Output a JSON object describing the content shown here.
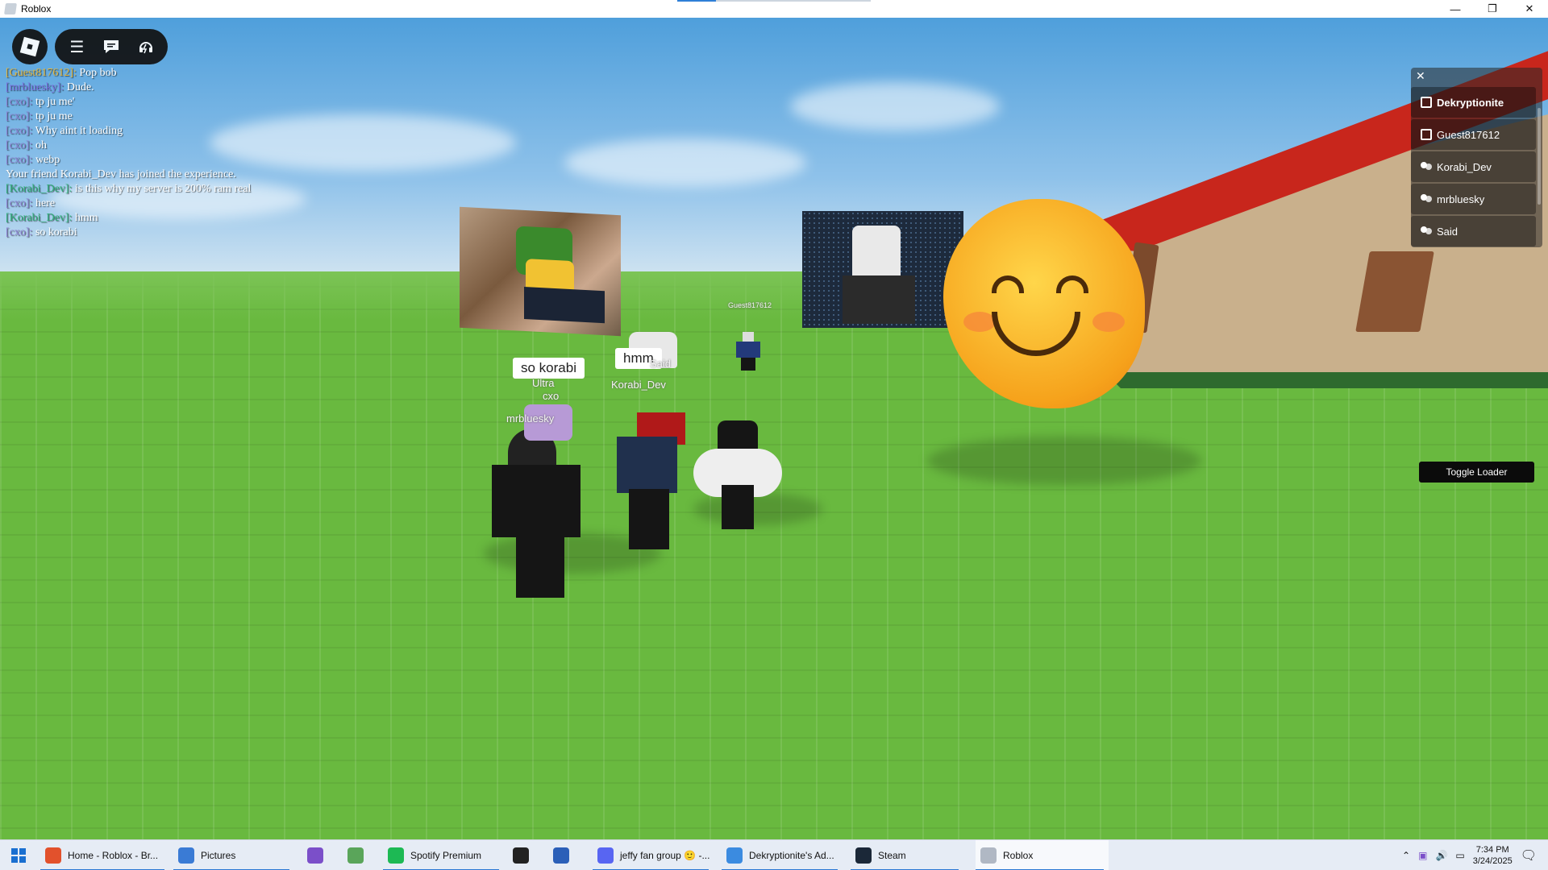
{
  "window": {
    "title": "Roblox",
    "loading_progress": 0.2
  },
  "menu": {
    "roblox_button_label": "",
    "icons": [
      "hamburger-icon",
      "chat-icon",
      "voice-icon"
    ]
  },
  "chat": {
    "messages": [
      {
        "name": "[Guest817612]:",
        "text": " Pop bob",
        "color": "#e6b73c"
      },
      {
        "name": "[mrbluesky]:",
        "text": " Dude.",
        "color": "#7a6fe0"
      },
      {
        "name": "[cxo]:",
        "text": " tp ju me'",
        "color": "#8b7fd3"
      },
      {
        "name": "[cxo]:",
        "text": " tp ju me",
        "color": "#8b7fd3"
      },
      {
        "name": "[cxo]:",
        "text": " Why aint it loading",
        "color": "#8b7fd3"
      },
      {
        "name": "[cxo]:",
        "text": " oh",
        "color": "#8b7fd3"
      },
      {
        "name": "[cxo]:",
        "text": " webp",
        "color": "#8b7fd3"
      },
      {
        "name": "",
        "text": "Your friend Korabi_Dev has joined the experience.",
        "color": "#ffffff"
      },
      {
        "name": "[Korabi_Dev]:",
        "text": " is this why my server is 200% ram real",
        "color": "#2fb07a"
      },
      {
        "name": "[cxo]:",
        "text": " here",
        "color": "#8b7fd3"
      },
      {
        "name": "[Korabi_Dev]:",
        "text": " hmm",
        "color": "#2fb07a"
      },
      {
        "name": "[cxo]:",
        "text": " so korabi",
        "color": "#8b7fd3"
      }
    ]
  },
  "player_list": {
    "close": "✕",
    "players": [
      {
        "name": "Dekryptionite",
        "icon": "premium-icon"
      },
      {
        "name": "Guest817612",
        "icon": "premium-icon"
      },
      {
        "name": "Korabi_Dev",
        "icon": "friend-icon"
      },
      {
        "name": "mrbluesky",
        "icon": "friend-icon"
      },
      {
        "name": "Said",
        "icon": "friend-icon"
      }
    ]
  },
  "world": {
    "bubbles": {
      "cxo": "so korabi",
      "korabi": "hmm"
    },
    "nametags": {
      "ultra": "Ultra",
      "cxo": "cxo",
      "mrbluesky": "mrbluesky",
      "korabi": "Korabi_Dev",
      "said": "Said",
      "guest": "Guest817612"
    }
  },
  "toggle_loader": "Toggle Loader",
  "taskbar": {
    "items": [
      {
        "label": "Home - Roblox - Br...",
        "icon": "brave-icon",
        "color": "#e2512c"
      },
      {
        "label": "Pictures",
        "icon": "photos-icon",
        "color": "#3a7bd5"
      },
      {
        "label": "",
        "icon": "visual-studio-icon",
        "color": "#7b4fc9"
      },
      {
        "label": "",
        "icon": "notepad-icon",
        "color": "#5aa55a"
      },
      {
        "label": "Spotify Premium",
        "icon": "spotify-icon",
        "color": "#1db954"
      },
      {
        "label": "",
        "icon": "terminal-icon",
        "color": "#222222"
      },
      {
        "label": "",
        "icon": "powershell-icon",
        "color": "#2b5fb8"
      },
      {
        "label": "jeffy fan group 🙂 -...",
        "icon": "discord-icon",
        "color": "#5865f2"
      },
      {
        "label": "Dekryptionite's Ad...",
        "icon": "app-icon",
        "color": "#3b8be0"
      },
      {
        "label": "Steam",
        "icon": "steam-icon",
        "color": "#1b2838"
      },
      {
        "label": "Roblox",
        "icon": "roblox-icon",
        "color": "#b0b8c4"
      }
    ],
    "time": "7:34 PM",
    "date": "3/24/2025"
  }
}
